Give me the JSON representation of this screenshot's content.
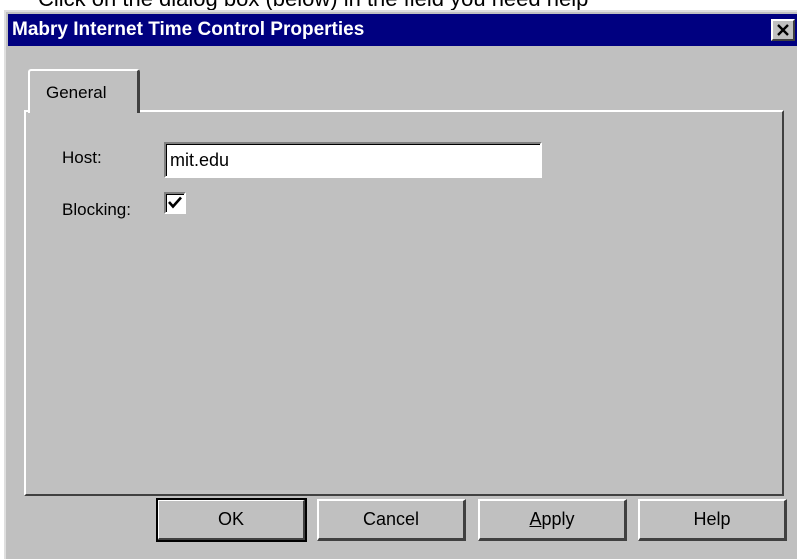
{
  "page": {
    "caption": "Click on the dialog box (below) in the field you need help"
  },
  "dialog": {
    "title": "Mabry Internet Time Control Properties",
    "close_icon": "close-x-icon"
  },
  "tabs": [
    {
      "label": "General",
      "selected": true
    }
  ],
  "general": {
    "host_label": "Host:",
    "host_value": "mit.edu",
    "blocking_label": "Blocking:",
    "blocking_checked": true
  },
  "buttons": {
    "ok": "OK",
    "cancel": "Cancel",
    "apply": "Apply",
    "help": "Help"
  },
  "colors": {
    "titlebar": "#000080",
    "face": "#c0c0c0"
  }
}
